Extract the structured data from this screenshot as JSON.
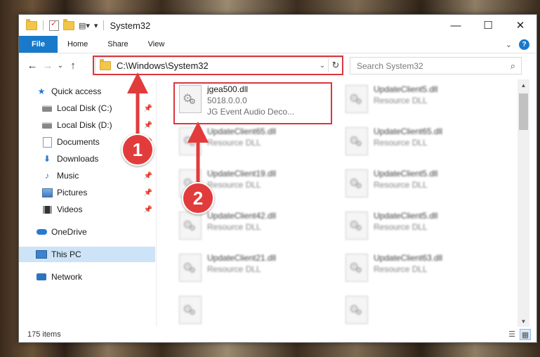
{
  "window": {
    "title": "System32",
    "qa_view_glyph": "▤▾",
    "qa_customize_glyph": "▾"
  },
  "controls": {
    "minimize": "—",
    "maximize": "☐",
    "close": "✕"
  },
  "ribbon": {
    "tabs": [
      "File",
      "Home",
      "Share",
      "View"
    ],
    "expand_glyph": "⌄",
    "help_glyph": "?"
  },
  "nav": {
    "back": "←",
    "forward": "→",
    "recent": "⌄",
    "up": "↑"
  },
  "address": {
    "path": "C:\\Windows\\System32",
    "dropdown_glyph": "⌄",
    "refresh_glyph": "↻"
  },
  "search": {
    "placeholder": "Search System32",
    "icon_glyph": "⌕"
  },
  "sidebar": {
    "items": [
      {
        "label": "Quick access",
        "icon": "star-icon"
      },
      {
        "label": "Local Disk (C:)",
        "icon": "drive-icon",
        "pinned": true
      },
      {
        "label": "Local Disk (D:)",
        "icon": "drive-icon",
        "pinned": true
      },
      {
        "label": "Documents",
        "icon": "documents-icon",
        "pinned": true
      },
      {
        "label": "Downloads",
        "icon": "downloads-icon",
        "pinned": true
      },
      {
        "label": "Music",
        "icon": "music-icon",
        "pinned": true
      },
      {
        "label": "Pictures",
        "icon": "pictures-icon",
        "pinned": true
      },
      {
        "label": "Videos",
        "icon": "videos-icon",
        "pinned": true
      },
      {
        "label": "OneDrive",
        "icon": "onedrive-icon"
      },
      {
        "label": "This PC",
        "icon": "pc-icon",
        "selected": true
      },
      {
        "label": "Network",
        "icon": "network-icon"
      }
    ],
    "pin_glyph": "📌"
  },
  "files": {
    "highlighted": {
      "name": "jgea500.dll",
      "version": "5018.0.0.0",
      "description": "JG Event Audio Deco..."
    },
    "blurred": [
      {
        "name": "UpdateClient5.dll",
        "type": "Resource DLL"
      },
      {
        "name": "UpdateClient65.dll",
        "type": "Resource DLL"
      },
      {
        "name": "UpdateClient65.dll",
        "type": "Resource DLL"
      },
      {
        "name": "UpdateClient19.dll",
        "type": "Resource DLL"
      },
      {
        "name": "UpdateClient5.dll",
        "type": "Resource DLL"
      },
      {
        "name": "UpdateClient42.dll",
        "type": "Resource DLL"
      },
      {
        "name": "UpdateClient5.dll",
        "type": "Resource DLL"
      },
      {
        "name": "UpdateClient21.dll",
        "type": "Resource DLL"
      },
      {
        "name": "UpdateClient63.dll",
        "type": "Resource DLL"
      }
    ]
  },
  "scrollbar": {
    "up": "▲",
    "down": "▼"
  },
  "status": {
    "count": "175 items",
    "details_view_glyph": "☰",
    "tiles_view_glyph": "▦"
  },
  "callouts": {
    "one": "1",
    "two": "2"
  },
  "colors": {
    "accent": "#1979ca",
    "callout": "#e23b3b",
    "highlight_box": "#d9363e"
  }
}
